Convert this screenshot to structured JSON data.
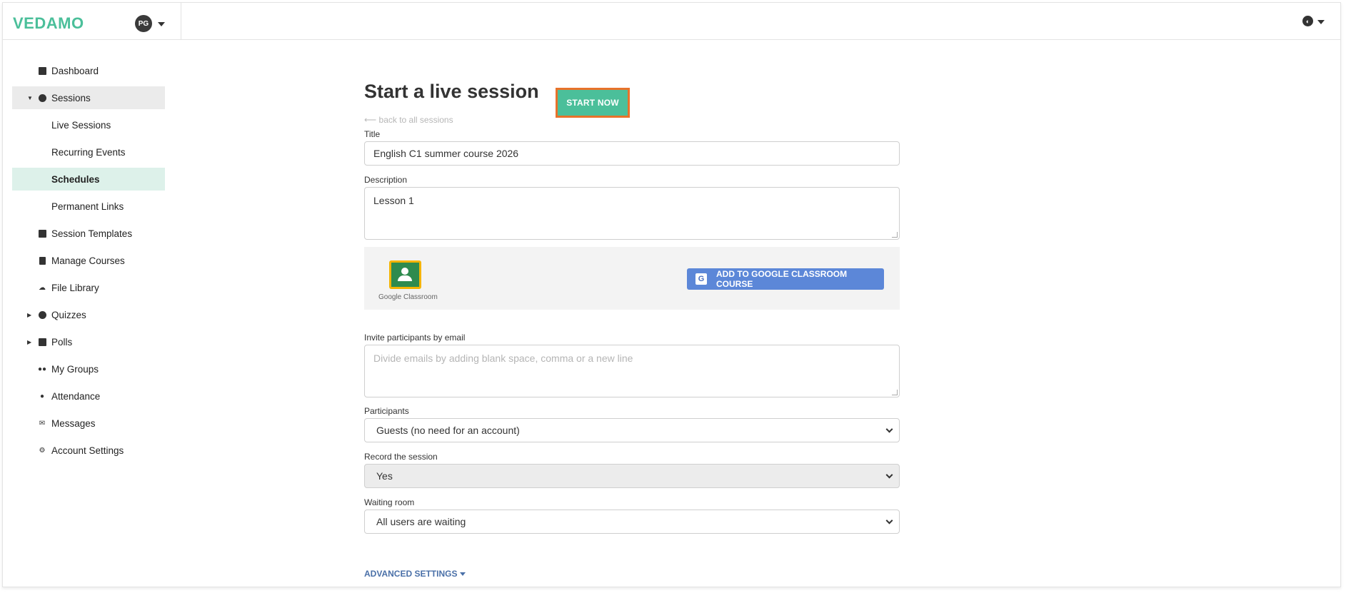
{
  "app": {
    "logo": "VEDAMO",
    "user_initials": "PG"
  },
  "sidebar": {
    "items": [
      {
        "label": "Dashboard"
      },
      {
        "label": "Sessions"
      },
      {
        "label": "Live Sessions"
      },
      {
        "label": "Recurring Events"
      },
      {
        "label": "Schedules"
      },
      {
        "label": "Permanent Links"
      },
      {
        "label": "Session Templates"
      },
      {
        "label": "Manage Courses"
      },
      {
        "label": "File Library"
      },
      {
        "label": "Quizzes"
      },
      {
        "label": "Polls"
      },
      {
        "label": "My Groups"
      },
      {
        "label": "Attendance"
      },
      {
        "label": "Messages"
      },
      {
        "label": "Account Settings"
      }
    ]
  },
  "main": {
    "title": "Start a live session",
    "start_button": "START NOW",
    "back_link": "⟵ back to all sessions",
    "title_label": "Title",
    "title_value": "English C1 summer course 2026",
    "description_label": "Description",
    "description_value": "Lesson 1",
    "google_classroom_caption": "Google Classroom",
    "google_classroom_button": "ADD TO GOOGLE CLASSROOM COURSE",
    "invite_label": "Invite participants by email",
    "invite_placeholder": "Divide emails by adding blank space, comma or a new line",
    "participants_label": "Participants",
    "participants_value": "Guests (no need for an account)",
    "record_label": "Record the session",
    "record_value": "Yes",
    "waiting_label": "Waiting room",
    "waiting_value": "All users are waiting",
    "advanced_settings": "ADVANCED SETTINGS"
  },
  "colors": {
    "brand": "#4bbf9a",
    "highlight_border": "#e8722a",
    "google_button": "#5c87d8",
    "active_item_bg": "#ddf1ea"
  }
}
